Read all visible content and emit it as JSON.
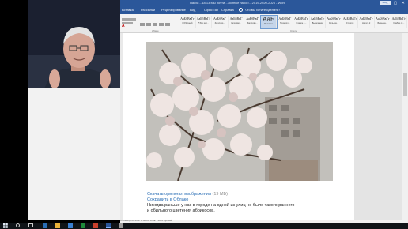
{
  "window": {
    "title": "Пасхи…18.13 Мы почти…лонные набор…2019-2020-2026 - Word",
    "signin_label": "Вход",
    "controls": "– ▢ ✕"
  },
  "ribbon": {
    "tabs": [
      "Вставка",
      "Рассылки",
      "Рецензирование",
      "Вид",
      "Офис Tab",
      "Справка"
    ],
    "search_label": "Что вы хотите сделать?",
    "styles": [
      {
        "sample": "АаБбВвГг",
        "name": "1 Обычный"
      },
      {
        "sample": "АаБбВвГг",
        "name": "¶ Без инт..."
      },
      {
        "sample": "АаБбВвГ",
        "name": "Заголово..."
      },
      {
        "sample": "АаБбВвГ",
        "name": "Заголово..."
      },
      {
        "sample": "АаБбВвГ",
        "name": "Заголово..."
      },
      {
        "sample": "АаБ",
        "name": "Название"
      },
      {
        "sample": "АаБбВвГ",
        "name": "Подзагол..."
      },
      {
        "sample": "АаБбВвГг",
        "name": "Слабое в..."
      },
      {
        "sample": "АаБбВвГг",
        "name": "Выделение"
      },
      {
        "sample": "АаБбВвГг",
        "name": "Сильное..."
      },
      {
        "sample": "АаБбВвГг",
        "name": "Строгий"
      },
      {
        "sample": "АаБбВвГг",
        "name": "Цитата 2"
      },
      {
        "sample": "АаБбВвГг",
        "name": "Выделен..."
      },
      {
        "sample": "АаБбВвГг",
        "name": "Слабая сс..."
      }
    ],
    "group_paragraph": "Абзац",
    "group_styles": "Стили"
  },
  "document": {
    "link_line": "Скачать оригинал изображения",
    "link_size": "(19 МБ)",
    "save_link": "Сохранить в Облако",
    "text_line_1": "Никогда раньше у нас в городе на одной из улиц не было такого раннего",
    "text_line_2": "и обильного цветения абрикосов."
  },
  "status": {
    "text": "Страница 20 из 276   Число слов: 74826   русский"
  },
  "taskbar": {
    "clock_time": "",
    "clock_date": ""
  }
}
